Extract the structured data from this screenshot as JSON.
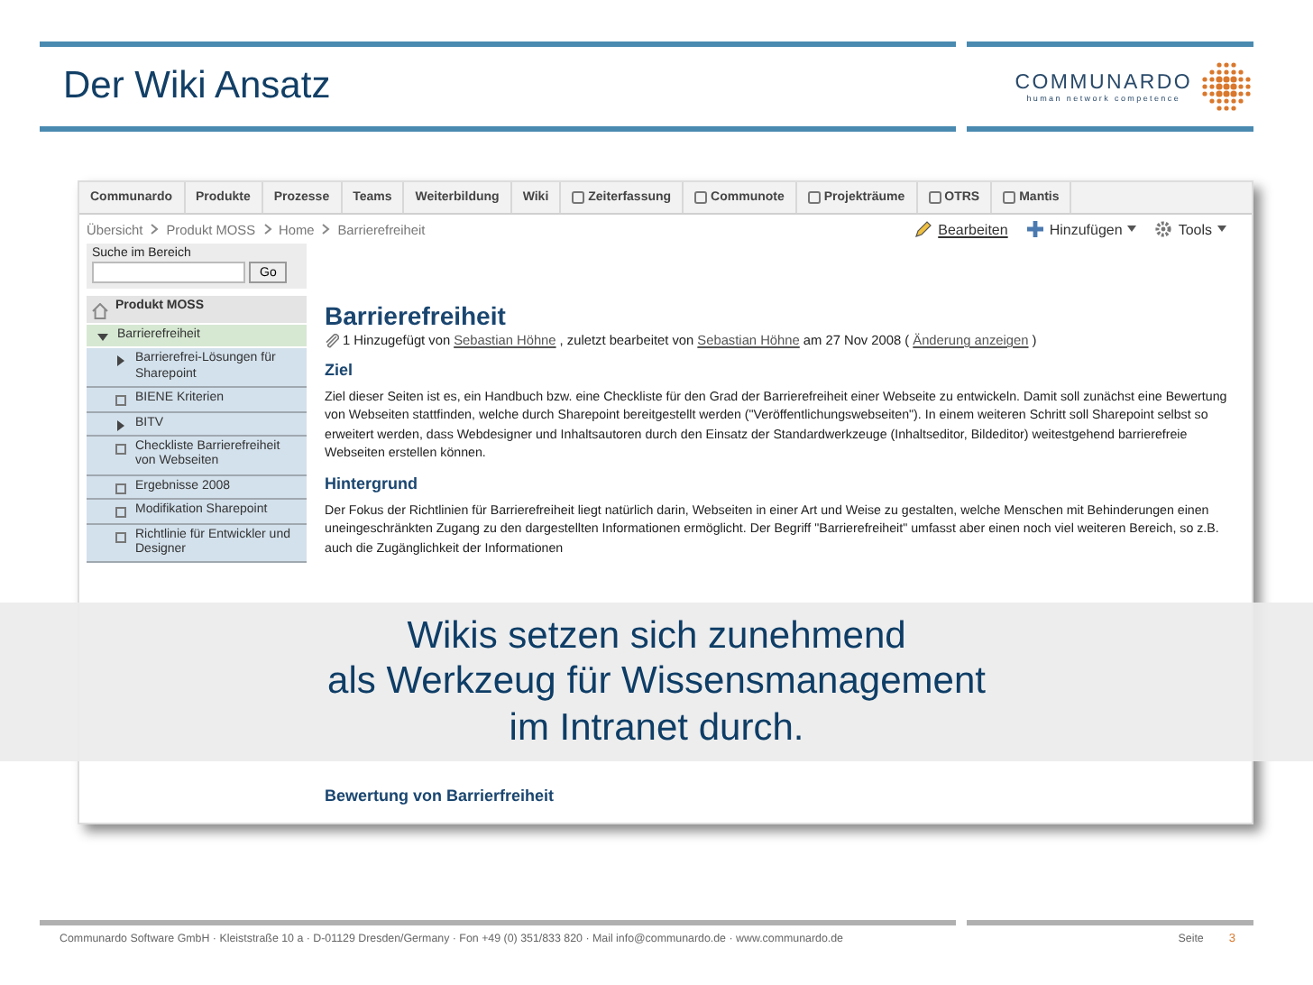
{
  "slide": {
    "title": "Der Wiki Ansatz",
    "logo": {
      "name": "COMMUNARDO",
      "tagline": "human network competence"
    }
  },
  "wiki": {
    "nav_tabs": [
      {
        "label": "Communardo",
        "kind": "section"
      },
      {
        "label": "Produkte",
        "kind": "section"
      },
      {
        "label": "Prozesse",
        "kind": "section"
      },
      {
        "label": "Teams",
        "kind": "section"
      },
      {
        "label": "Weiterbildung",
        "kind": "section"
      },
      {
        "label": "Wiki",
        "kind": "section"
      },
      {
        "label": "Zeiterfassung",
        "kind": "tool"
      },
      {
        "label": "Communote",
        "kind": "tool"
      },
      {
        "label": "Projekträume",
        "kind": "tool"
      },
      {
        "label": "OTRS",
        "kind": "tool"
      },
      {
        "label": "Mantis",
        "kind": "tool"
      }
    ],
    "breadcrumb": [
      "Übersicht",
      "Produkt MOSS",
      "Home",
      "Barrierefreiheit"
    ],
    "actions": [
      {
        "label": "Bearbeiten",
        "kind": "edit"
      },
      {
        "label": "Hinzufügen",
        "kind": "add"
      },
      {
        "label": "Tools",
        "kind": "tools"
      }
    ],
    "search": {
      "label": "Suche im Bereich",
      "button": "Go"
    },
    "tree": [
      {
        "label": "Produkt MOSS",
        "kind": "space",
        "children": [
          {
            "label": "Barrierefreiheit",
            "kind": "folder",
            "expanded": true,
            "selected": true,
            "children": [
              {
                "label": "Barrierefrei-Lösungen für Sharepoint",
                "kind": "folder",
                "expanded": false,
                "selected": false
              },
              {
                "label": "BIENE Kriterien",
                "kind": "page",
                "selected": false
              },
              {
                "label": "BITV",
                "kind": "folder",
                "expanded": false,
                "selected": false
              },
              {
                "label": "Checkliste Barrierefreiheit von Webseiten",
                "kind": "page",
                "selected": false
              },
              {
                "label": "Ergebnisse 2008",
                "kind": "page",
                "selected": false
              },
              {
                "label": "Modifikation Sharepoint",
                "kind": "page",
                "selected": false
              },
              {
                "label": "Richtlinie für Entwickler und Designer",
                "kind": "page",
                "selected": false
              }
            ]
          }
        ]
      }
    ],
    "page": {
      "title": "Barrierefreiheit",
      "meta": [
        {
          "text": "1 Hinzugefügt von",
          "link": false
        },
        {
          "text": "Sebastian Höhne",
          "link": true
        },
        {
          "text": ", zuletzt bearbeitet von",
          "link": false
        },
        {
          "text": "Sebastian Höhne",
          "link": true
        },
        {
          "text": "am 27 Nov 2008 (",
          "link": false
        },
        {
          "text": "Änderung anzeigen",
          "link": true
        },
        {
          "text": ")",
          "link": false
        }
      ],
      "sections": [
        {
          "heading": "Ziel",
          "text": "Ziel dieser Seiten ist es, ein Handbuch bzw. eine Checkliste für den Grad der Barrierefreiheit einer Webseite zu entwickeln. Damit soll zunächst eine Bewertung von Webseiten stattfinden, welche durch Sharepoint bereitgestellt werden (\"Veröffentlichungswebseiten\"). In einem weiteren Schritt soll Sharepoint selbst so erweitert werden, dass Webdesigner und Inhaltsautoren durch den Einsatz der Standardwerkzeuge (Inhaltseditor, Bildeditor) weitestgehend barrierefreie Webseiten erstellen können."
        },
        {
          "heading": "Hintergrund",
          "text": "Der Fokus der Richtlinien für Barrierefreiheit liegt natürlich darin, Webseiten in einer Art und Weise zu gestalten, welche Menschen mit Behinderungen einen uneingeschränkten Zugang zu den dargestellten Informationen ermöglicht. Der Begriff \"Barrierefreiheit\" umfasst aber einen noch viel weiteren Bereich, so z.B. auch die Zugänglichkeit der Informationen"
        },
        {
          "heading": "Bewertung von Barrierfreiheit"
        }
      ]
    }
  },
  "overlay_lines": [
    "Wikis setzen sich zunehmend",
    "als Werkzeug für Wissensmanagement",
    "im Intranet durch."
  ],
  "footer": {
    "address": "Communardo Software GmbH · Kleiststraße 10 a · D-01129 Dresden/Germany  · Fon +49 (0) 351/833 820 · Mail info@communardo.de · www.communardo.de",
    "page_label": "Seite",
    "page_number": "3"
  }
}
